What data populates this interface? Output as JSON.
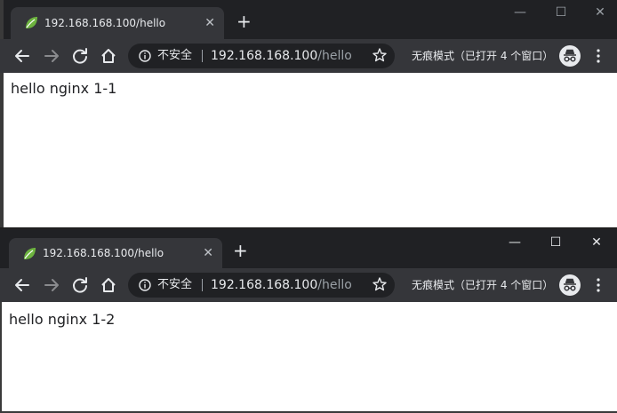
{
  "windows": [
    {
      "tab": {
        "title": "192.168.168.100/hello",
        "close": "✕"
      },
      "newtab": "+",
      "controls": {
        "minimize": "—",
        "maximize": "☐",
        "close": "✕"
      },
      "omnibox": {
        "security": "不安全",
        "host": "192.168.168.100",
        "path": "/hello"
      },
      "incognito_text": "无痕模式（已打开 4 个窗口）",
      "content_text": "hello nginx 1-1"
    },
    {
      "tab": {
        "title": "192.168.168.100/hello",
        "close": "✕"
      },
      "newtab": "+",
      "controls": {
        "minimize": "—",
        "maximize": "☐",
        "close": "✕"
      },
      "omnibox": {
        "security": "不安全",
        "host": "192.168.168.100",
        "path": "/hello"
      },
      "incognito_text": "无痕模式（已打开 4 个窗口）",
      "content_text": "hello nginx 1-2"
    }
  ],
  "colors": {
    "frame": "#202124",
    "toolbar": "#35363a",
    "favicon": "#6db33f",
    "text": "#e8eaed"
  },
  "icons": [
    "spring-leaf-favicon-icon",
    "back-arrow-icon",
    "forward-arrow-icon",
    "reload-icon",
    "home-icon",
    "info-icon",
    "star-icon",
    "incognito-icon",
    "kebab-menu-icon"
  ]
}
